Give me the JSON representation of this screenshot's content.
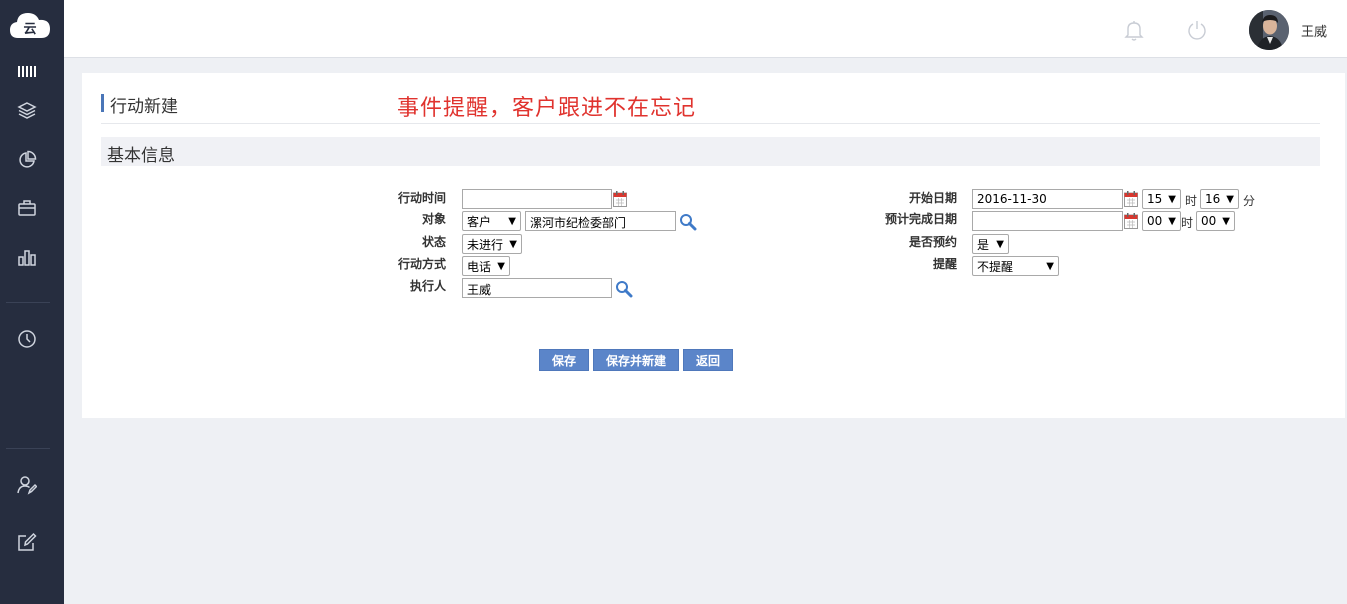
{
  "sidebar": {
    "logo_text": "云",
    "icons": [
      "menu-icon",
      "layers-icon",
      "pie-chart-icon",
      "briefcase-icon",
      "bar-chart-icon",
      "clock-icon",
      "user-edit-icon",
      "edit-icon"
    ]
  },
  "header": {
    "icons": [
      "bell-icon",
      "power-icon"
    ],
    "username": "王威"
  },
  "page": {
    "title": "行动新建",
    "slogan": "事件提醒，客户跟进不在忘记",
    "section_title": "基本信息"
  },
  "form": {
    "left": {
      "action_time_label": "行动时间",
      "action_time_value": "",
      "target_label": "对象",
      "target_type": "客户",
      "target_value": "漯河市纪检委部门",
      "status_label": "状态",
      "status_value": "未进行",
      "method_label": "行动方式",
      "method_value": "电话",
      "executor_label": "执行人",
      "executor_value": "王威"
    },
    "right": {
      "start_date_label": "开始日期",
      "start_date_value": "2016-11-30",
      "start_hour": "15",
      "start_minute": "16",
      "hour_unit": "时",
      "minute_unit": "分",
      "end_date_label": "预计完成日期",
      "end_date_value": "",
      "end_hour": "00",
      "end_minute": "00",
      "appointment_label": "是否预约",
      "appointment_value": "是",
      "reminder_label": "提醒",
      "reminder_value": "不提醒"
    }
  },
  "buttons": {
    "save": "保存",
    "save_new": "保存并新建",
    "back": "返回"
  },
  "colors": {
    "sidebar_bg": "#262d3f",
    "accent": "#5b85c9",
    "slogan": "#e0332e"
  }
}
